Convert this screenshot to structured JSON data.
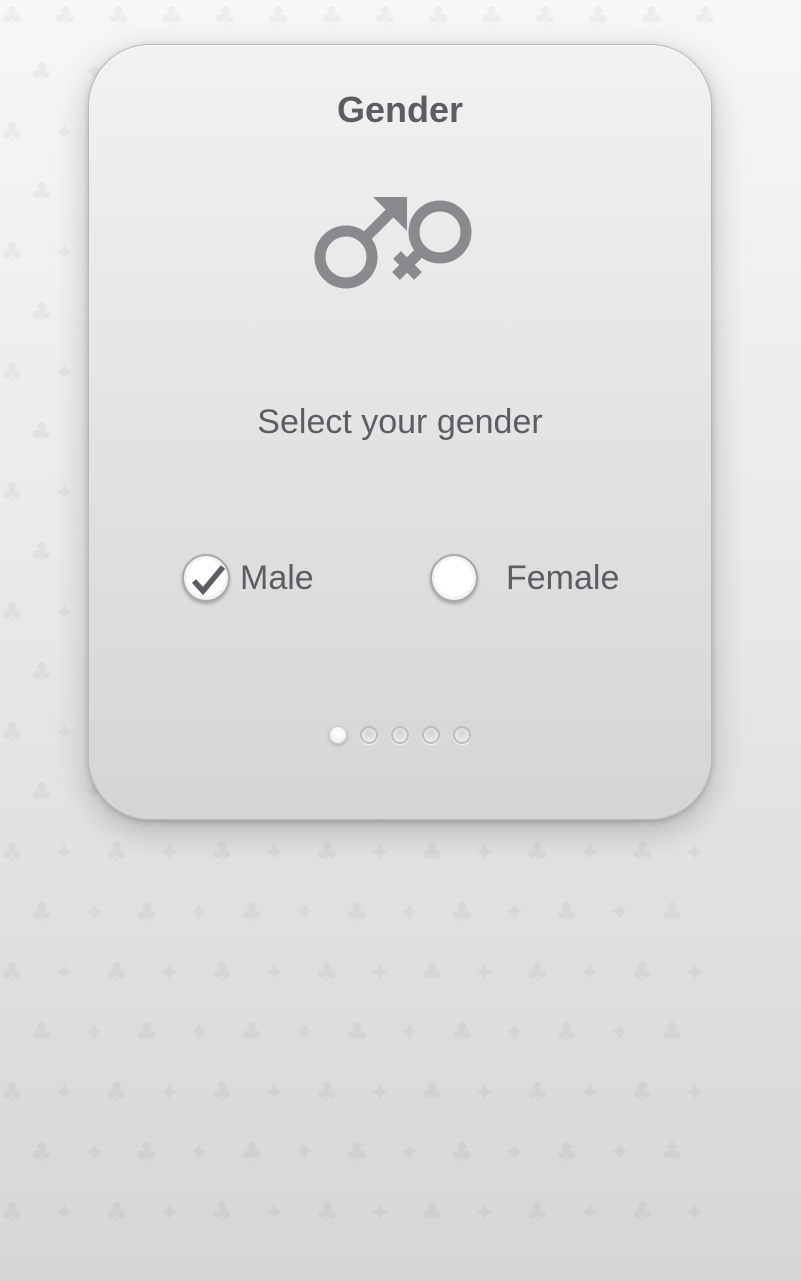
{
  "card": {
    "title": "Gender",
    "icon": "male-female-icon",
    "subtitle": "Select your gender"
  },
  "options": [
    {
      "label": "Male",
      "selected": true
    },
    {
      "label": "Female",
      "selected": false
    }
  ],
  "pager": {
    "total": 5,
    "current": 1
  },
  "colors": {
    "text": "#5b5d63",
    "icon": "#888a8e"
  }
}
